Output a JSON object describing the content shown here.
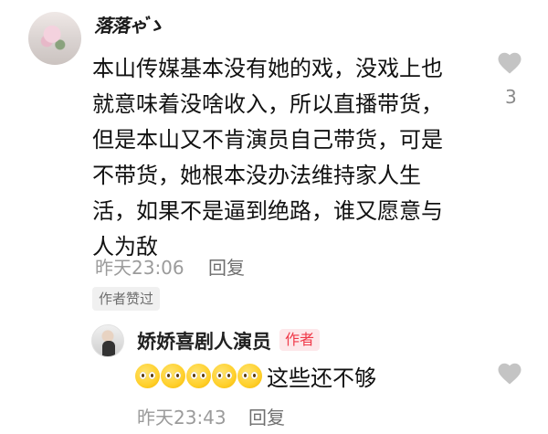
{
  "comment": {
    "username": "落落ゃ゙ゝ",
    "avatar_icon": "user-avatar-icon",
    "text": "本山传媒基本没有她的戏，没戏上也\n就意味着没啥收入，所以直播带货，\n但是本山又不肯演员自己带货，可是\n不带货，她根本没办法维持家人生\n活，如果不是逼到绝路，谁又愿意与\n人为敌",
    "time": "昨天23:06",
    "reply_label": "回复",
    "liked_badge": "作者赞过",
    "like_count": "3"
  },
  "reply": {
    "username": "娇娇喜剧人演员",
    "author_tag": "作者",
    "emoji_names": [
      "pleading-face-icon",
      "pleading-face-icon",
      "pleading-face-icon",
      "pleading-face-icon",
      "pleading-face-icon"
    ],
    "text": "这些还不够",
    "time": "昨天23:43",
    "reply_label": "回复"
  },
  "colors": {
    "heart": "#c4c4c4",
    "author_tag_text": "#f03a4a",
    "author_tag_bg": "#fde7ea"
  }
}
